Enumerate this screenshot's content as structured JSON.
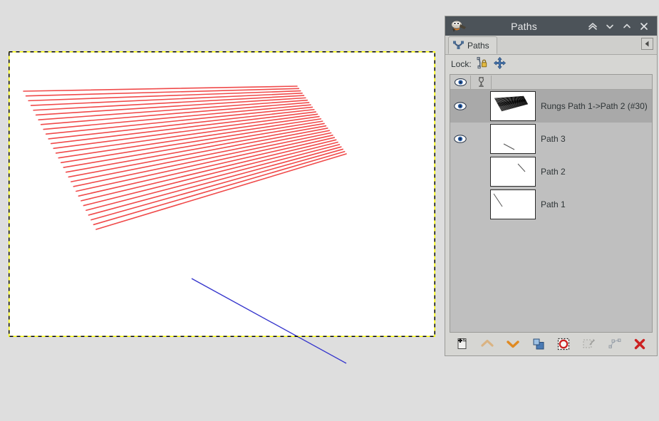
{
  "app": {
    "window_title": "Paths",
    "titlebar_icon": "wilber-icon",
    "titlebar_buttons": [
      {
        "name": "shade-button",
        "icon": "double-chevron-up-icon"
      },
      {
        "name": "minimize-button",
        "icon": "chevron-down-icon"
      },
      {
        "name": "maximize-button",
        "icon": "chevron-up-icon"
      },
      {
        "name": "close-button",
        "icon": "close-x-icon"
      }
    ]
  },
  "tabstrip": {
    "tabs": [
      {
        "label": "Paths",
        "icon": "paths-tab-icon",
        "active": true
      }
    ],
    "menu_button_icon": "tab-menu-triangle-icon"
  },
  "lockbar": {
    "label": "Lock:",
    "toggles": [
      {
        "name": "lock-path-toggle",
        "icon": "path-lock-icon"
      },
      {
        "name": "lock-position-toggle",
        "icon": "move-lock-icon"
      }
    ]
  },
  "list_header": {
    "visibility_column_icon": "eye-icon",
    "link_column_icon": "chain-link-icon"
  },
  "paths": [
    {
      "name": "Rungs Path 1->Path 2 (#30)",
      "visible": true,
      "selected": true,
      "thumbnail": "fan-of-lines"
    },
    {
      "name": "Path 3",
      "visible": true,
      "selected": false,
      "thumbnail": "diagonal-line-lower-middle"
    },
    {
      "name": "Path 2",
      "visible": false,
      "selected": false,
      "thumbnail": "diagonal-line-upper-right"
    },
    {
      "name": "Path 1",
      "visible": false,
      "selected": false,
      "thumbnail": "diagonal-line-upper-left"
    }
  ],
  "bottom_toolbar": [
    {
      "name": "new-path-button",
      "icon": "new-page-plus-icon",
      "enabled": true
    },
    {
      "name": "raise-path-button",
      "icon": "chevron-up-icon",
      "enabled": false
    },
    {
      "name": "lower-path-button",
      "icon": "chevron-down-icon",
      "enabled": true
    },
    {
      "name": "duplicate-path-button",
      "icon": "duplicate-icon",
      "enabled": true
    },
    {
      "name": "path-to-selection-button",
      "icon": "path-to-selection-icon",
      "enabled": true
    },
    {
      "name": "selection-to-path-button",
      "icon": "selection-to-path-icon",
      "enabled": false
    },
    {
      "name": "stroke-path-button",
      "icon": "stroke-path-icon",
      "enabled": false
    },
    {
      "name": "delete-path-button",
      "icon": "delete-x-icon",
      "enabled": true
    }
  ],
  "canvas": {
    "background_color": "#dedede",
    "page_color": "#ffffff",
    "boundary_style": "yellow-black-dashed",
    "rungs_color": "#f04a4a",
    "rungs_count": 30,
    "blue_path_color": "#3333cc",
    "blue_path_from": [
      269,
      391
    ],
    "blue_path_to": [
      486,
      510
    ]
  }
}
